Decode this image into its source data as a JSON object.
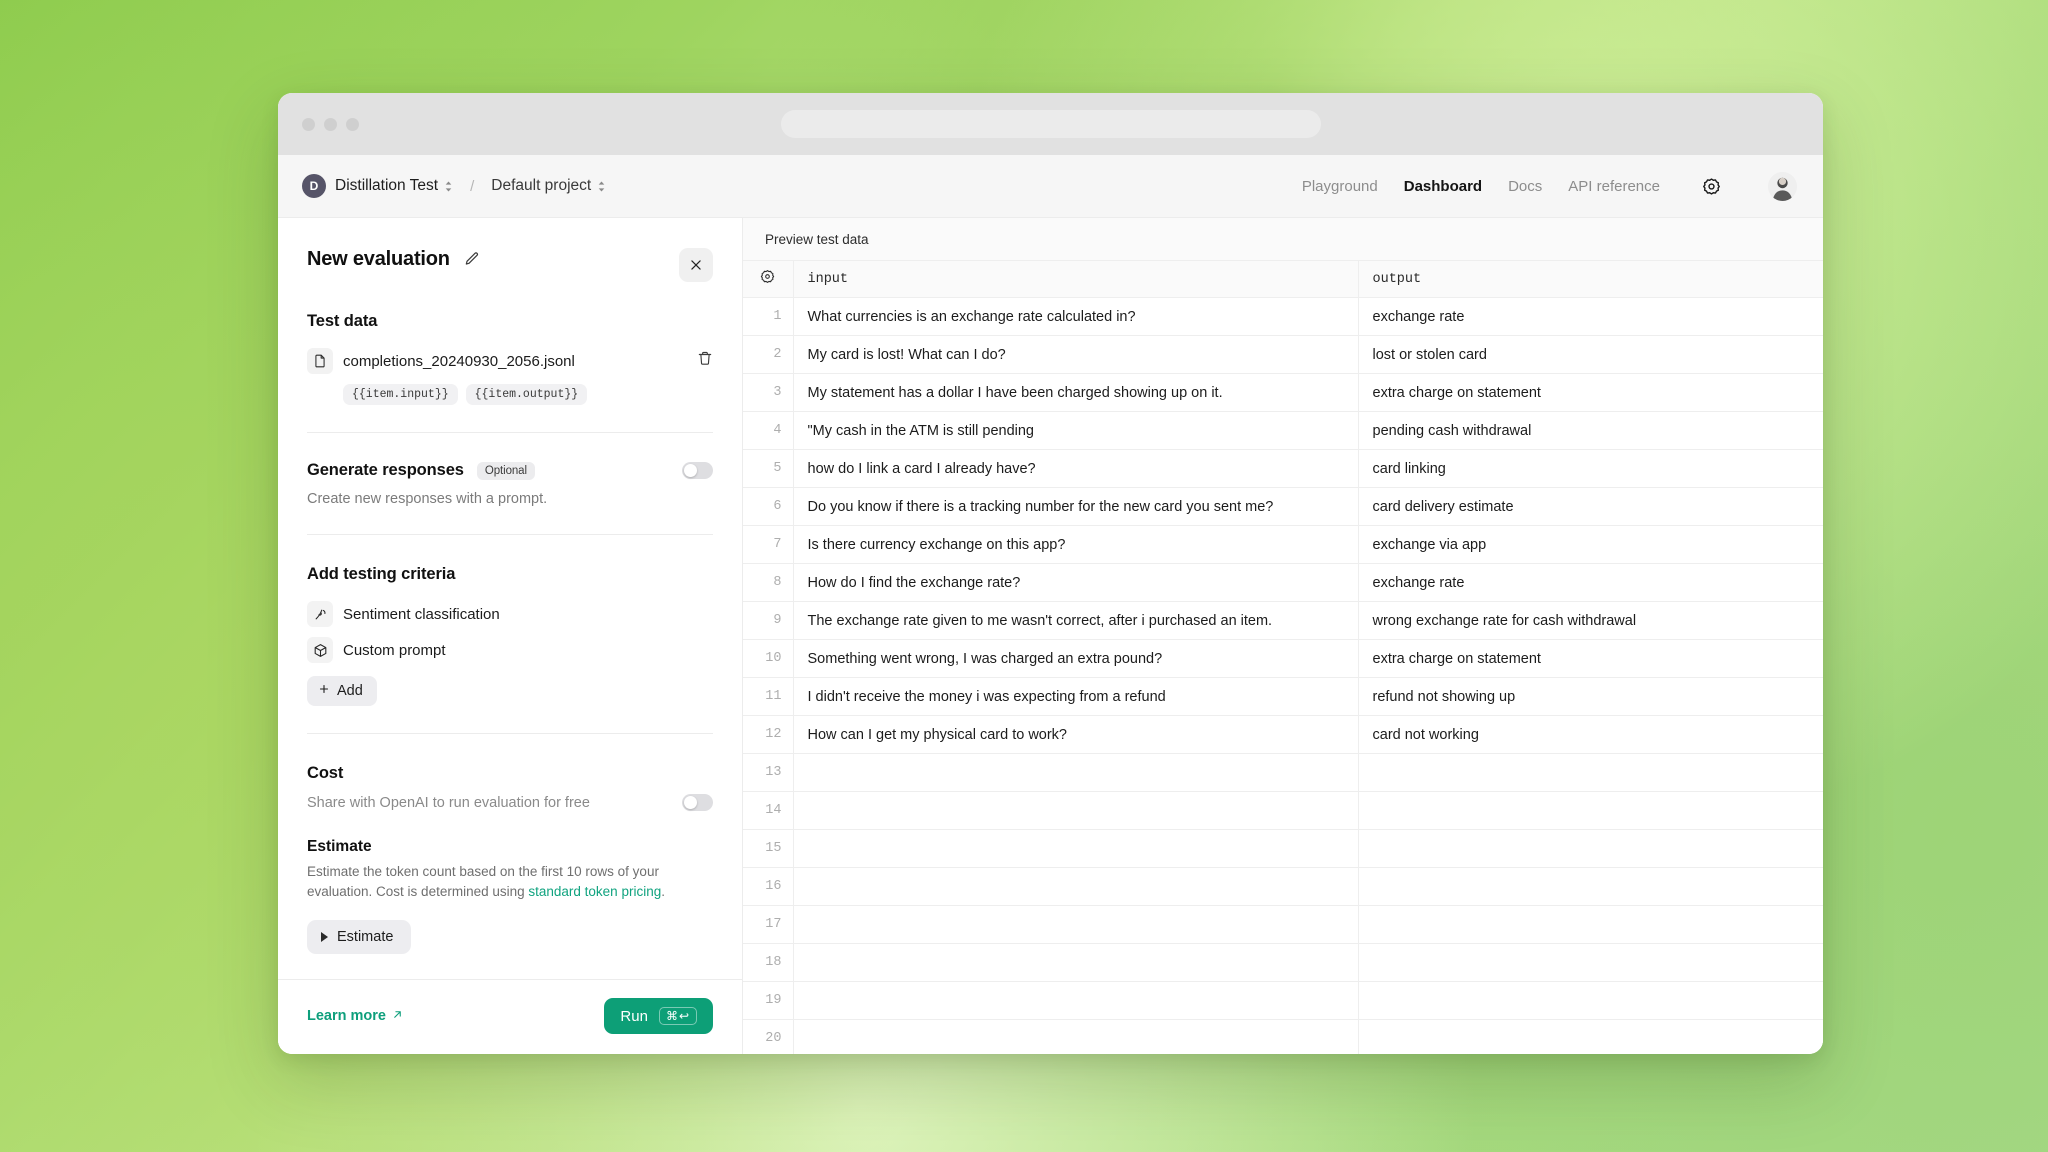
{
  "window": {
    "traffic_lights": [
      "close",
      "minimize",
      "maximize"
    ],
    "url_value": ""
  },
  "header": {
    "org_initial": "D",
    "org_name": "Distillation Test",
    "separator": "/",
    "project_name": "Default project",
    "nav": [
      {
        "label": "Playground",
        "active": false
      },
      {
        "label": "Dashboard",
        "active": true
      },
      {
        "label": "Docs",
        "active": false
      },
      {
        "label": "API reference",
        "active": false
      }
    ],
    "settings_icon": "gear-icon",
    "avatar_icon": "user-avatar"
  },
  "panel": {
    "title": "New evaluation",
    "edit_icon": "pencil-icon",
    "close_icon": "close-icon",
    "test_data": {
      "heading": "Test data",
      "file_icon": "file-icon",
      "file_name": "completions_20240930_2056.jsonl",
      "delete_icon": "trash-icon",
      "tags": [
        "{{item.input}}",
        "{{item.output}}"
      ]
    },
    "generate_responses": {
      "heading": "Generate responses",
      "badge": "Optional",
      "description": "Create new responses with a prompt.",
      "toggle_on": false
    },
    "testing_criteria": {
      "heading": "Add testing criteria",
      "items": [
        {
          "label": "Sentiment classification",
          "icon": "sentiment-icon"
        },
        {
          "label": "Custom prompt",
          "icon": "cube-icon"
        }
      ],
      "add_label": "Add",
      "add_icon": "plus-icon"
    },
    "cost": {
      "heading": "Cost",
      "share_label": "Share with OpenAI to run evaluation for free",
      "share_toggle_on": false,
      "estimate_heading": "Estimate",
      "estimate_desc_1": "Estimate the token count based on the first 10 rows of your evaluation. Cost is determined using ",
      "estimate_link": "standard token pricing",
      "estimate_desc_2": ".",
      "estimate_button": "Estimate",
      "estimate_icon": "play-icon"
    },
    "footer": {
      "learn_more": "Learn more",
      "learn_more_icon": "external-link-arrow",
      "run_label": "Run",
      "run_shortcut": "⌘↩"
    }
  },
  "table": {
    "preview_label": "Preview test data",
    "gear_icon": "gear-icon",
    "columns": [
      "input",
      "output"
    ],
    "rows": [
      {
        "n": "1",
        "input": "What currencies is an exchange rate calculated in?",
        "output": "exchange rate"
      },
      {
        "n": "2",
        "input": "My card is lost! What can I do?",
        "output": "lost or stolen card"
      },
      {
        "n": "3",
        "input": "My statement has a dollar I have been charged showing up on it.",
        "output": "extra charge on statement"
      },
      {
        "n": "4",
        "input": "\"My cash in the ATM is still pending",
        "output": "pending cash withdrawal"
      },
      {
        "n": "5",
        "input": "how do I link a card I already have?",
        "output": "card linking"
      },
      {
        "n": "6",
        "input": "Do you know if there is a tracking number for the new card you sent me?",
        "output": "card delivery estimate"
      },
      {
        "n": "7",
        "input": "Is there currency exchange on this app?",
        "output": "exchange via app"
      },
      {
        "n": "8",
        "input": "How do I find the exchange rate?",
        "output": "exchange rate"
      },
      {
        "n": "9",
        "input": "The exchange rate given to me wasn't correct, after i purchased an item.",
        "output": "wrong exchange rate for cash withdrawal"
      },
      {
        "n": "10",
        "input": "Something went wrong, I was charged an extra pound?",
        "output": "extra charge on statement"
      },
      {
        "n": "11",
        "input": "I didn't receive the money i was expecting from a refund",
        "output": "refund not showing up"
      },
      {
        "n": "12",
        "input": "How can I get my physical card to work?",
        "output": "card not working"
      },
      {
        "n": "13",
        "input": "",
        "output": ""
      },
      {
        "n": "14",
        "input": "",
        "output": ""
      },
      {
        "n": "15",
        "input": "",
        "output": ""
      },
      {
        "n": "16",
        "input": "",
        "output": ""
      },
      {
        "n": "17",
        "input": "",
        "output": ""
      },
      {
        "n": "18",
        "input": "",
        "output": ""
      },
      {
        "n": "19",
        "input": "",
        "output": ""
      },
      {
        "n": "20",
        "input": "",
        "output": ""
      }
    ]
  },
  "colors": {
    "accent_green": "#0d9f77",
    "link_green": "#10a37f",
    "background_green_start": "#8ECC4E",
    "background_green_end": "#A9DC8C"
  }
}
